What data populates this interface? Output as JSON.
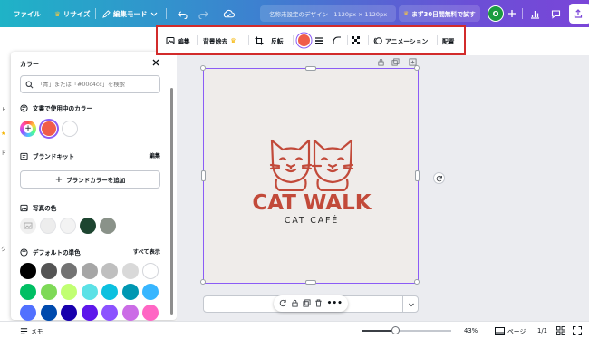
{
  "topbar": {
    "file": "ファイル",
    "resize": "リサイズ",
    "edit_mode": "編集モード",
    "design_name": "名称未設定のデザイン - 1120px × 1120px",
    "trial": "まず30日間無料で試す",
    "avatar_initial": "O"
  },
  "context_toolbar": {
    "edit": "編集",
    "bg_remove": "背景除去",
    "flip": "反転",
    "animation": "アニメーション",
    "position": "配置"
  },
  "color_panel": {
    "title": "カラー",
    "search_placeholder": "「青」または「#00c4cc」を検索",
    "doc_colors_label": "文書で使用中のカラー",
    "brand_kit_label": "ブランドキット",
    "brand_kit_edit": "編集",
    "add_brand_color": "ブランドカラーを追加",
    "photo_colors_label": "写真の色",
    "default_solid_label": "デフォルトの単色",
    "show_all": "すべて表示",
    "doc_colors": [
      "#f05d4a",
      "#ffffff"
    ],
    "photo_colors": [
      "#ededed",
      "#f3f3f3",
      "#1d4530",
      "#8a9289"
    ],
    "default_row1": [
      "#000000",
      "#545454",
      "#737373",
      "#a6a6a6",
      "#bfbfbf",
      "#d9d9d9",
      "#ffffff"
    ],
    "default_row2": [
      "#00bf63",
      "#7ed957",
      "#c1ff72",
      "#5ce1e6",
      "#0cc0df",
      "#0097b2",
      "#38b6ff"
    ],
    "default_row3": [
      "#5271ff",
      "#004aad",
      "#1800ad",
      "#5e17eb",
      "#8c52ff",
      "#cb6ce6",
      "#ff66c4"
    ]
  },
  "canvas": {
    "logo_title": "CAT WALK",
    "logo_subtitle": "CAT CAFÉ",
    "brand_color": "#c24a3a",
    "selection_color": "#8b5cf6"
  },
  "bottombar": {
    "notes": "メモ",
    "zoom_percent": "43%",
    "zoom_level": 0.43,
    "pages_label": "ページ",
    "page_count": "1/1"
  }
}
